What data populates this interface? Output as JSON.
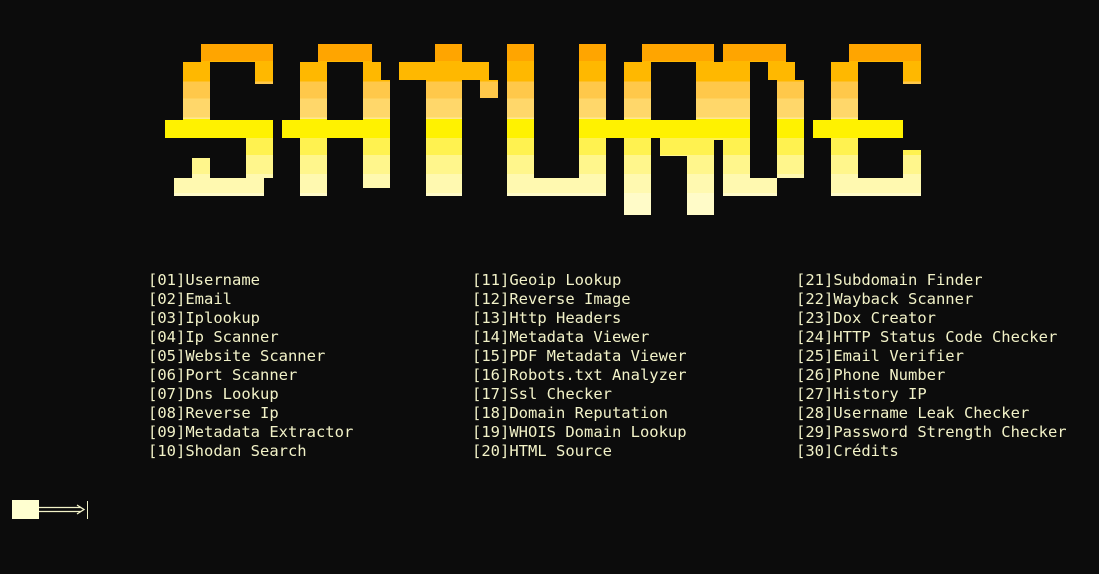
{
  "banner": {
    "text": "SATURNE",
    "gradient": [
      "#ffa500",
      "#ffb700",
      "#ffc94a",
      "#ffd86a",
      "#ffe98a",
      "#fff200",
      "#fff34f",
      "#fff68a",
      "#fff9b0",
      "#fffbc8"
    ]
  },
  "menu": {
    "columns": [
      [
        {
          "id": "[01]",
          "label": "Username"
        },
        {
          "id": "[02]",
          "label": "Email"
        },
        {
          "id": "[03]",
          "label": "Iplookup"
        },
        {
          "id": "[04]",
          "label": "Ip Scanner"
        },
        {
          "id": "[05]",
          "label": "Website Scanner"
        },
        {
          "id": "[06]",
          "label": "Port Scanner"
        },
        {
          "id": "[07]",
          "label": "Dns Lookup"
        },
        {
          "id": "[08]",
          "label": "Reverse Ip"
        },
        {
          "id": "[09]",
          "label": "Metadata Extractor"
        },
        {
          "id": "[10]",
          "label": "Shodan Search"
        }
      ],
      [
        {
          "id": "[11]",
          "label": "Geoip Lookup"
        },
        {
          "id": "[12]",
          "label": "Reverse Image"
        },
        {
          "id": "[13]",
          "label": "Http Headers"
        },
        {
          "id": "[14]",
          "label": "Metadata Viewer"
        },
        {
          "id": "[15]",
          "label": "PDF Metadata Viewer"
        },
        {
          "id": "[16]",
          "label": "Robots.txt Analyzer"
        },
        {
          "id": "[17]",
          "label": "Ssl Checker"
        },
        {
          "id": "[18]",
          "label": "Domain Reputation"
        },
        {
          "id": "[19]",
          "label": "WHOIS Domain Lookup"
        },
        {
          "id": "[20]",
          "label": "HTML Source"
        }
      ],
      [
        {
          "id": "[21]",
          "label": "Subdomain Finder"
        },
        {
          "id": "[22]",
          "label": "Wayback Scanner"
        },
        {
          "id": "[23]",
          "label": "Dox Creator"
        },
        {
          "id": "[24]",
          "label": "HTTP Status Code Checker"
        },
        {
          "id": "[25]",
          "label": "Email Verifier"
        },
        {
          "id": "[26]",
          "label": "Phone Number"
        },
        {
          "id": "[27]",
          "label": "History IP"
        },
        {
          "id": "[28]",
          "label": "Username Leak Checker"
        },
        {
          "id": "[29]",
          "label": "Password Strength Checker"
        },
        {
          "id": "[30]",
          "label": "Crédits"
        }
      ]
    ]
  },
  "prompt": {
    "arrow_icon": "double-arrow-icon",
    "input_value": ""
  },
  "colors": {
    "background": "#0c0c0c",
    "text": "#f2f2c8"
  }
}
